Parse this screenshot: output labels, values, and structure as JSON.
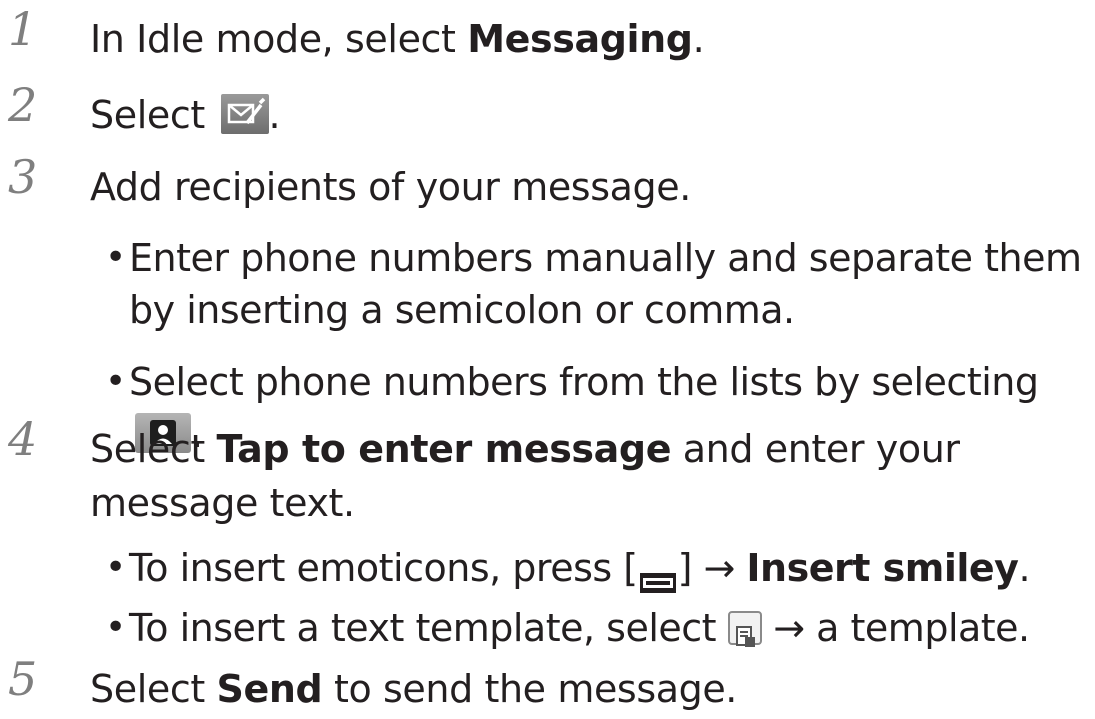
{
  "steps": [
    {
      "number": "1",
      "pre": "In Idle mode, select ",
      "bold": "Messaging",
      "post": "."
    },
    {
      "number": "2",
      "pre": "Select ",
      "icon": "compose-message-icon",
      "post": "."
    },
    {
      "number": "3",
      "text": "Add recipients of your message."
    },
    {
      "number": "4",
      "pre": "Select ",
      "bold": "Tap to enter message",
      "post": " and enter your message text."
    },
    {
      "number": "5",
      "pre": "Select ",
      "bold": "Send",
      "post": " to send the message."
    }
  ],
  "step3_bullets": [
    {
      "text": "Enter phone numbers manually and separate them by inserting a semicolon or comma."
    },
    {
      "pre": "Select phone numbers from the lists by selecting ",
      "icon": "contact-icon",
      "post": "."
    }
  ],
  "step4_bullets": [
    {
      "pre": "To insert emoticons, press [",
      "icon": "menu-key-icon",
      "mid": "] ",
      "arrow": "→",
      "bold": "Insert smiley",
      "post": "."
    },
    {
      "pre": "To insert a text template, select ",
      "icon": "template-icon",
      "arrow": "→",
      "post": " a template."
    }
  ],
  "bullet_glyph": "•",
  "colors": {
    "step_number": "#7f7f7f",
    "text": "#231f20",
    "icon_fill": "#7a7a7a"
  }
}
